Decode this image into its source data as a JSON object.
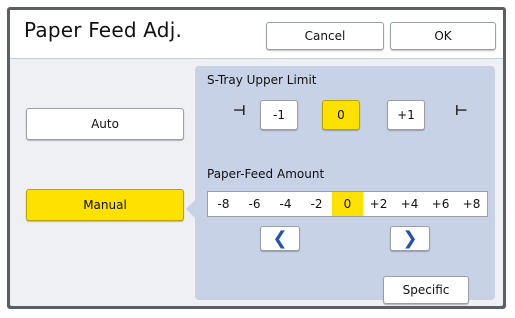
{
  "title": "Paper Feed Adj.",
  "buttons": {
    "cancel": "Cancel",
    "ok": "OK"
  },
  "modes": {
    "auto": "Auto",
    "manual": "Manual",
    "selected": "Manual"
  },
  "s_tray": {
    "label": "S-Tray Upper Limit",
    "options": [
      "-1",
      "0",
      "+1"
    ],
    "selected": "0"
  },
  "paper_feed": {
    "label": "Paper-Feed Amount",
    "values": [
      "-8",
      "-6",
      "-4",
      "-2",
      "0",
      "+2",
      "+4",
      "+6",
      "+8"
    ],
    "selected": "0"
  },
  "specific_label": "Specific",
  "colors": {
    "accent": "#ffe100",
    "panel": "#c8d2e6",
    "arrow": "#2255aa"
  },
  "icons": {
    "prev": "chevron-left-icon",
    "next": "chevron-right-icon",
    "limit_left": "limit-left-icon",
    "limit_right": "limit-right-icon"
  }
}
